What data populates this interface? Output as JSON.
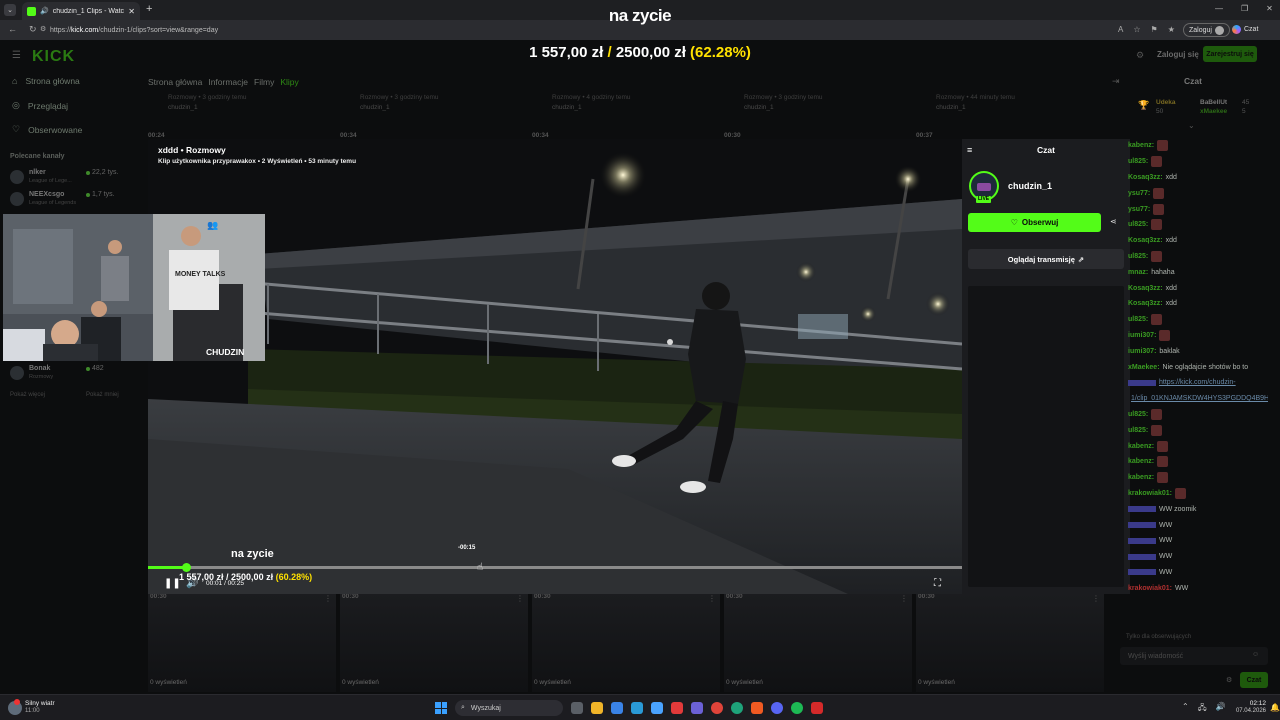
{
  "browser": {
    "tab_title": "chudzin_1 Clips - Watch Live",
    "url_prefix": "https://",
    "url_domain": "kick.com",
    "url_path": "/chudzin-1/clips?sort=view&range=day",
    "login_label": "Zaloguj",
    "extension_label": "Czat"
  },
  "overlay": {
    "title": "na zycie",
    "goal_current": "1 557,00 zł",
    "goal_separator": " / ",
    "goal_target": "2500,00 zł",
    "goal_percent": "(62.28%)"
  },
  "site": {
    "logo": "KICK",
    "login_button": "Zaloguj się",
    "signup_button": "Zarejestruj się"
  },
  "sidebar": {
    "nav": [
      {
        "label": "Strona główna",
        "icon": "home-icon"
      },
      {
        "label": "Przeglądaj",
        "icon": "compass-icon"
      },
      {
        "label": "Obserwowane",
        "icon": "heart-icon"
      }
    ],
    "section_title": "Polecane kanały",
    "channels": [
      {
        "name": "nlker",
        "category": "League of Lege...",
        "viewers": "22,2 tys."
      },
      {
        "name": "NEEXcsgo",
        "category": "League of Legends",
        "viewers": "1,7 tys."
      },
      {
        "name": "Bonak",
        "category": "Rozmowy",
        "viewers": "482"
      }
    ],
    "more_label": "Pokaż więcej",
    "less_label": "Pokaż mniej"
  },
  "channel_tabs": [
    "Strona główna",
    "Informacje",
    "Filmy",
    "Klipy"
  ],
  "clip_cards_top": [
    {
      "meta": "Rozmowy • 3 godziny temu",
      "channel": "chudzin_1",
      "duration": "00:24"
    },
    {
      "meta": "Rozmowy • 3 godziny temu",
      "channel": "chudzin_1",
      "duration": "00:34"
    },
    {
      "meta": "Rozmowy • 4 godziny temu",
      "channel": "chudzin_1",
      "duration": "00:34"
    },
    {
      "meta": "Rozmowy • 3 godziny temu",
      "channel": "chudzin_1",
      "duration": "00:30"
    },
    {
      "meta": "Rozmowy • 44 minuty temu",
      "channel": "chudzin_1",
      "duration": "00:37"
    }
  ],
  "clip_cards_bottom": [
    {
      "duration": "00:30",
      "views": "0 wyświetleń"
    },
    {
      "duration": "00:30",
      "views": "0 wyświetleń"
    },
    {
      "duration": "00:30",
      "views": "0 wyświetleń"
    },
    {
      "duration": "00:30",
      "views": "0 wyświetleń"
    },
    {
      "duration": "00:30",
      "views": "0 wyświetleń"
    }
  ],
  "player": {
    "title": "xddd • Rozmowy",
    "subtitle": "Klip użytkownika przyprawakox • 2 Wyświetleń • 53 minuty temu",
    "time": "00:01 / 00:25",
    "hover_time": "-00:15",
    "progress_fraction": 0.047,
    "overlay_title": "na zycie",
    "overlay_goal": "1 557,00 zł / 2500,00 zł",
    "overlay_percent": "(60.28%)"
  },
  "cam": {
    "label": "CHUDZIN",
    "shirt_text": "MONEY TALKS"
  },
  "popup_chat": {
    "title": "Czat",
    "channel": "chudzin_1",
    "live_badge": "LIVE",
    "follow_button": "Obserwuj",
    "watch_button": "Oglądaj transmisję"
  },
  "chat": {
    "title": "Czat",
    "pinned": [
      {
        "name": "Udeka",
        "count": "50"
      },
      {
        "name": "BaBellUt",
        "count": "45"
      },
      {
        "name": "xMaekee",
        "count": "5"
      }
    ],
    "messages": [
      {
        "user": "kabenz:",
        "text": ""
      },
      {
        "user": "ul825:",
        "text": ""
      },
      {
        "user": "Kosaq3zz:",
        "text": "xdd"
      },
      {
        "user": "ysu77:",
        "text": ""
      },
      {
        "user": "ysu77:",
        "text": ""
      },
      {
        "user": "ul825:",
        "text": ""
      },
      {
        "user": "Kosaq3zz:",
        "text": "xdd"
      },
      {
        "user": "ul825:",
        "text": ""
      },
      {
        "user": "mnaz:",
        "text": "hahaha"
      },
      {
        "user": "Kosaq3zz:",
        "text": "xdd"
      },
      {
        "user": "Kosaq3zz:",
        "text": "xdd"
      },
      {
        "user": "ul825:",
        "text": ""
      },
      {
        "user": "iumi307:",
        "text": ""
      },
      {
        "user": "iumi307:",
        "text": "baklak"
      },
      {
        "user": "xMaekee:",
        "text": "Nie oglądajcie shotów bo to"
      },
      {
        "user": "",
        "text": "https://kick.com/chudzin-"
      },
      {
        "user": "",
        "text": "1/clip_01KNJAMSKDW4HYS3PGDDQ4B9H"
      },
      {
        "user": "ul825:",
        "text": ""
      },
      {
        "user": "ul825:",
        "text": ""
      },
      {
        "user": "kabenz:",
        "text": ""
      },
      {
        "user": "kabenz:",
        "text": ""
      },
      {
        "user": "kabenz:",
        "text": ""
      },
      {
        "user": "krakowiak01:",
        "text": ""
      },
      {
        "user": "",
        "text": "WW zoomik"
      },
      {
        "user": "",
        "text": "WW"
      },
      {
        "user": "",
        "text": "WW"
      },
      {
        "user": "",
        "text": "WW"
      },
      {
        "user": "",
        "text": "WW"
      },
      {
        "user": "krakowiak01:",
        "text": "WW"
      }
    ],
    "footer_note": "Tylko dla obserwujących",
    "input_placeholder": "Wyślij wiadomość",
    "send_button": "Czat"
  },
  "taskbar": {
    "weather_title": "Silny wiatr",
    "weather_sub": "11:00",
    "search_placeholder": "Wyszukaj",
    "time": "02:12",
    "date": "07.04.2026"
  }
}
